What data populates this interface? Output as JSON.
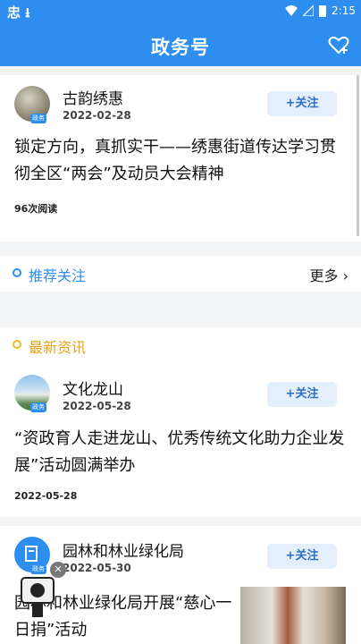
{
  "status_bar": {
    "carrier_glyphs": "忠 ⭳",
    "time": "2:15"
  },
  "header": {
    "title": "政务号"
  },
  "cards": [
    {
      "account": "古韵绣惠",
      "date": "2022-02-28",
      "follow_label": "+关注",
      "headline": "锁定方向，真抓实干——绣惠街道传达学习贯彻全区“两会”及动员大会精神",
      "meta": "96次阅读",
      "avatar_badge": "政务"
    },
    {
      "account": "文化龙山",
      "date": "2022-05-28",
      "follow_label": "+关注",
      "headline": "“资政育人走进龙山、优秀传统文化助力企业发展”活动圆满举办",
      "meta": "2022-05-28",
      "avatar_badge": "政务"
    },
    {
      "account": "园林和林业绿化局",
      "date": "2022-05-30",
      "follow_label": "+关注",
      "headline": "园林和林业绿化局开展“慈心一日捐”活动",
      "avatar_badge": "政务"
    }
  ],
  "sections": {
    "recommend_label": "推荐关注",
    "more_label": "更多",
    "latest_label": "最新资讯"
  },
  "colors": {
    "accent": "#2e8ef0",
    "latest_dot": "#f0b92a",
    "recommend_text": "#2e8ef0"
  }
}
